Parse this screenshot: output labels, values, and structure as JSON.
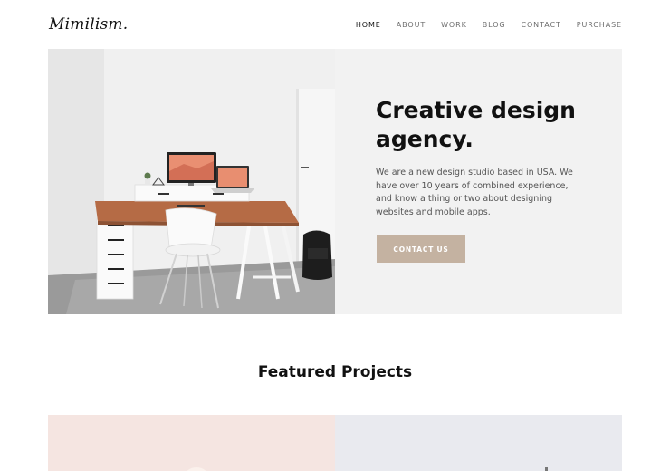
{
  "header": {
    "logo": "Mimilism.",
    "nav": [
      "HOME",
      "ABOUT",
      "WORK",
      "BLOG",
      "CONTACT",
      "PURCHASE"
    ],
    "active": "HOME"
  },
  "hero": {
    "title": "Creative design agency.",
    "description": "We are a new design studio based in USA. We have over 10 years of combined experience, and know a thing or two about designing websites and mobile apps.",
    "cta_label": "CONTACT US"
  },
  "featured": {
    "title": "Featured Projects",
    "projects": [
      {
        "color": "#f5e5e1"
      },
      {
        "color": "#e9eaef"
      }
    ]
  },
  "colors": {
    "accent": "#c4b2a1",
    "hero_bg": "#f2f2f2"
  }
}
